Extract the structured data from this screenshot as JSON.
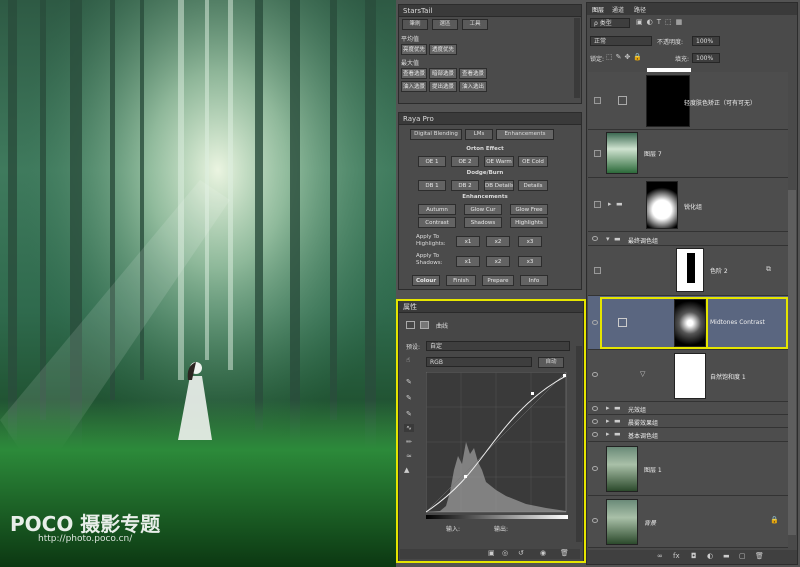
{
  "watermark": {
    "brand": "POCO 摄影专题",
    "url": "http://photo.poco.cn/"
  },
  "starstail": {
    "title": "StarsTail",
    "tabs": [
      "筆刷",
      "選區",
      "工具"
    ],
    "section1": "平均值",
    "btn1": [
      "亮度优先",
      "透度优先"
    ],
    "section2": "最大值",
    "row3": [
      "查看选景",
      "暗部选景",
      "查看选景"
    ],
    "row4": [
      "油入选景",
      "提出选景",
      "油入选出"
    ]
  },
  "raya": {
    "title": "Raya Pro",
    "tabs": [
      "Digital Blending",
      "LMs",
      "Enhancements"
    ],
    "orton": "Orton Effect",
    "orton_btns": [
      "OE 1",
      "OE 2",
      "OE Warm",
      "OE Cold"
    ],
    "dodge": "Dodge/Burn",
    "dodge_btns": [
      "DB 1",
      "DB 2",
      "DB Details",
      "Details"
    ],
    "enh": "Enhancements",
    "enh1": [
      "Autumn",
      "Glow Cur",
      "Glow Free"
    ],
    "enh2": [
      "Contrast",
      "Shadows",
      "Highlights"
    ],
    "apply_hl": "Apply To Highlights:",
    "apply_sh": "Apply To Shadows:",
    "x": [
      "x1",
      "x2",
      "x3"
    ],
    "bottom": [
      "Colour",
      "Finish",
      "Prepare",
      "Info"
    ]
  },
  "props": {
    "title": "属性",
    "kind": "曲线",
    "preset_label": "预设:",
    "preset_value": "自定",
    "channel": "RGB",
    "auto": "自动",
    "input": "输入:",
    "output": "输出:"
  },
  "layers_panel": {
    "tabs": [
      "图层",
      "通道",
      "路径"
    ],
    "filter": "ρ 类型",
    "blend": "正常",
    "opacity_label": "不透明度:",
    "opacity": "100%",
    "lock_label": "锁定:",
    "fill_label": "填充:",
    "fill": "100%"
  },
  "layers": [
    {
      "name": "轻度肤色矫正（可有可无）"
    },
    {
      "name": "图层 7"
    },
    {
      "name": "锐化组"
    },
    {
      "name": "最终调色组"
    },
    {
      "name": "色阶 2"
    },
    {
      "name": "Midtones Contrast"
    },
    {
      "name": "自然饱和度 1"
    },
    {
      "name": "光效组"
    },
    {
      "name": "晨雾效果组"
    },
    {
      "name": "基本调色组"
    },
    {
      "name": "图层 1"
    },
    {
      "name": "背景"
    }
  ],
  "colors": {
    "highlight": "#e5e500",
    "panel": "#4b4b4b",
    "selected": "#5a6680"
  }
}
